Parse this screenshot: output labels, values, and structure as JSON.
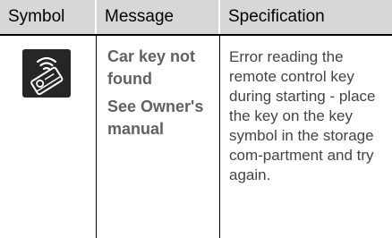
{
  "headers": {
    "symbol": "Symbol",
    "message": "Message",
    "specification": "Specification"
  },
  "row": {
    "symbol_icon": "car-key-remote-icon",
    "message_line1": "Car key not found",
    "message_line2": "See Owner's manual",
    "specification": "Error reading the remote control key during starting - place the key on the key symbol in the storage com-partment and try again."
  },
  "colors": {
    "header_background": "#d7d7d7",
    "icon_tile": "#262626",
    "message_text": "#616161",
    "spec_text": "#444444"
  }
}
